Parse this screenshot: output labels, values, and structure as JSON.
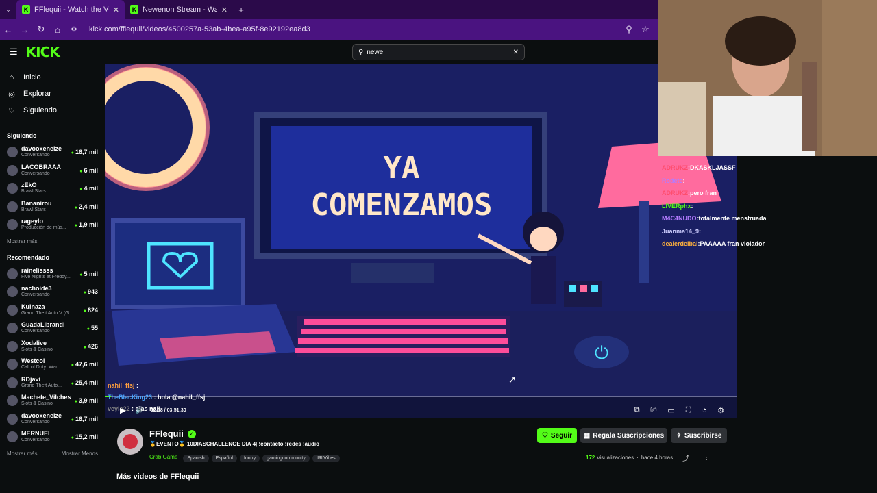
{
  "browser": {
    "tabs": [
      {
        "title": "FFlequii - Watch the VOD on K"
      },
      {
        "title": "Newenon Stream - Watch Live"
      }
    ],
    "url": "kick.com/fflequii/videos/4500257a-53ab-4bea-a95f-8e92192ea8d3"
  },
  "header": {
    "logo": "KICK",
    "search_value": "newe"
  },
  "sidebar": {
    "nav": [
      {
        "label": "Inicio",
        "icon": "home-icon"
      },
      {
        "label": "Explorar",
        "icon": "compass-icon"
      },
      {
        "label": "Siguiendo",
        "icon": "heart-icon"
      }
    ],
    "following_title": "Siguiendo",
    "following": [
      {
        "name": "davooxeneize",
        "cat": "Conversando",
        "viewers": "16,7 mil"
      },
      {
        "name": "LACOBRAAA",
        "cat": "Conversando",
        "viewers": "6 mil"
      },
      {
        "name": "zEkO",
        "cat": "Brawl Stars",
        "viewers": "4 mil"
      },
      {
        "name": "Bananirou",
        "cat": "Brawl Stars",
        "viewers": "2,4 mil"
      },
      {
        "name": "rageylo",
        "cat": "Producción de mús...",
        "viewers": "1,9 mil"
      }
    ],
    "show_more": "Mostrar más",
    "recommended_title": "Recomendado",
    "recommended": [
      {
        "name": "rainelissss",
        "cat": "Five Nights at Freddy...",
        "viewers": "5 mil"
      },
      {
        "name": "nachoide3",
        "cat": "Conversando",
        "viewers": "943"
      },
      {
        "name": "Kuinaza",
        "cat": "Grand Theft Auto V (G...",
        "viewers": "824"
      },
      {
        "name": "GuadaLibrandi",
        "cat": "Conversando",
        "viewers": "55"
      },
      {
        "name": "Xodalive",
        "cat": "Slots & Casino",
        "viewers": "426"
      },
      {
        "name": "Westcol",
        "cat": "Call of Duty: War...",
        "viewers": "47,6 mil"
      },
      {
        "name": "RDjavi",
        "cat": "Grand Theft Auto...",
        "viewers": "25,4 mil"
      },
      {
        "name": "Machete_Vilches",
        "cat": "Slots & Casino",
        "viewers": "3,9 mil"
      },
      {
        "name": "davooxeneize",
        "cat": "Conversando",
        "viewers": "16,7 mil"
      },
      {
        "name": "MERNUEL",
        "cat": "Conversando",
        "viewers": "15,2 mil"
      }
    ],
    "show_less": "Mostrar Menos"
  },
  "video": {
    "line1": "YA",
    "line2": "COMENZAMOS",
    "time": "02:18 / 03:51:30",
    "progress": 0.01
  },
  "overlay_chat": [
    {
      "user": "ADRUKZ",
      "msg": "DKASKLJASSF",
      "color": "#ff4d6d"
    },
    {
      "user": "Rodete",
      "msg": "",
      "color": "#b47cff"
    },
    {
      "user": "ADRUKZ",
      "msg": "pero fran",
      "color": "#ff4d6d"
    },
    {
      "user": "LIVERphx",
      "msg": "",
      "color": "#53fc18"
    },
    {
      "user": "M4C4NUDO",
      "msg": "totalmente menstruada",
      "color": "#b47cff"
    },
    {
      "user": "Juanma14_9",
      "msg": "",
      "color": "#cfcfff"
    },
    {
      "user": "dealerdeibai",
      "msg": "PAAAAA  fran violador",
      "color": "#ffb13d"
    }
  ],
  "video_chat": [
    {
      "user": "nahil_ffsj",
      "msg": "",
      "color": "#ff9f3d"
    },
    {
      "user": "TheBlacKing23",
      "msg": "hola @nahil_ffsj",
      "color": "#4da6ff"
    },
    {
      "user": "veyla22",
      "msg": "olas naji",
      "color": "#888888"
    }
  ],
  "channel": {
    "name": "FFlequii",
    "title": "🥇EVENTO🥇 10DIASCHALLENGE DIA 4| !contacto !redes !audio",
    "category": "Crab Game",
    "tags": [
      "Spanish",
      "Español",
      "funny",
      "gamingcommunity",
      "IRLVibes"
    ],
    "follow": "Seguir",
    "gift": "Regala Suscripciones",
    "subscribe": "Suscribirse",
    "views_num": "172",
    "views_label": "visualizaciones",
    "ago": "hace 4 horas"
  },
  "more_videos": "Más videos de FFlequii"
}
